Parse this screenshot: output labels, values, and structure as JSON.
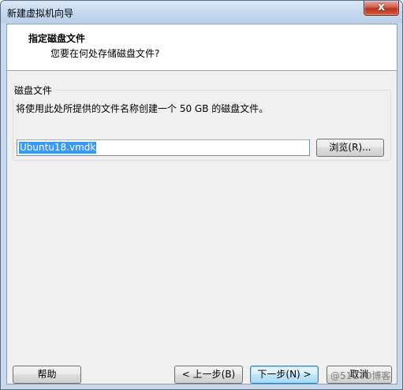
{
  "window": {
    "title": "新建虚拟机向导",
    "close_label": "x"
  },
  "header": {
    "title": "指定磁盘文件",
    "subtitle": "您要在何处存储磁盘文件?"
  },
  "disk_file_group": {
    "label": "磁盘文件",
    "description": "将使用此处所提供的文件名称创建一个 50 GB 的磁盘文件。",
    "filename_value": "Ubuntu18.vmdk",
    "browse_label": "浏览(R)..."
  },
  "footer": {
    "help_label": "帮助",
    "back_label": "< 上一步(B)",
    "next_label": "下一步(N) >",
    "cancel_label": "取消"
  },
  "watermark": {
    "text": "@51CTO博客"
  }
}
